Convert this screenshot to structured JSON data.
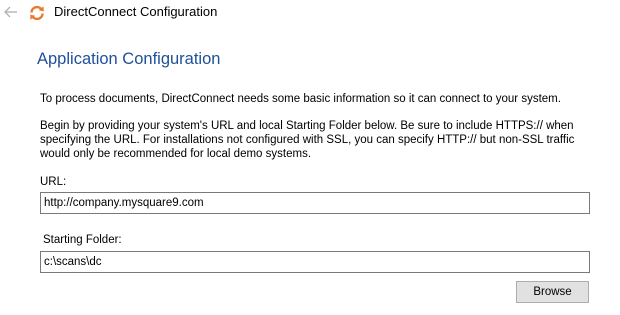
{
  "titlebar": {
    "back_icon": "back-arrow-icon",
    "app_icon": "sync-icon",
    "title": "DirectConnect Configuration"
  },
  "main": {
    "heading": "Application Configuration",
    "intro": "To process documents, DirectConnect needs some basic information so it can connect to your system.",
    "instructions_lines": [
      "Begin by providing your system's URL and local Starting Folder below.  Be sure to include HTTPS:// when",
      "specifying the URL.  For installations not configured with SSL, you can specify HTTP:// but non-SSL traffic",
      "would only be recommended for local demo systems."
    ],
    "url_label": "URL:",
    "url_value": "http://company.mysquare9.com",
    "folder_label": "Starting Folder:",
    "folder_value": "c:\\scans\\dc",
    "browse_label": "Browse"
  },
  "colors": {
    "heading": "#1f4f99",
    "icon_orange": "#e8792d",
    "back_arrow": "#b4b4b4",
    "input_border": "#7a7a7a",
    "button_bg": "#e1e1e1",
    "button_border": "#adadad"
  }
}
